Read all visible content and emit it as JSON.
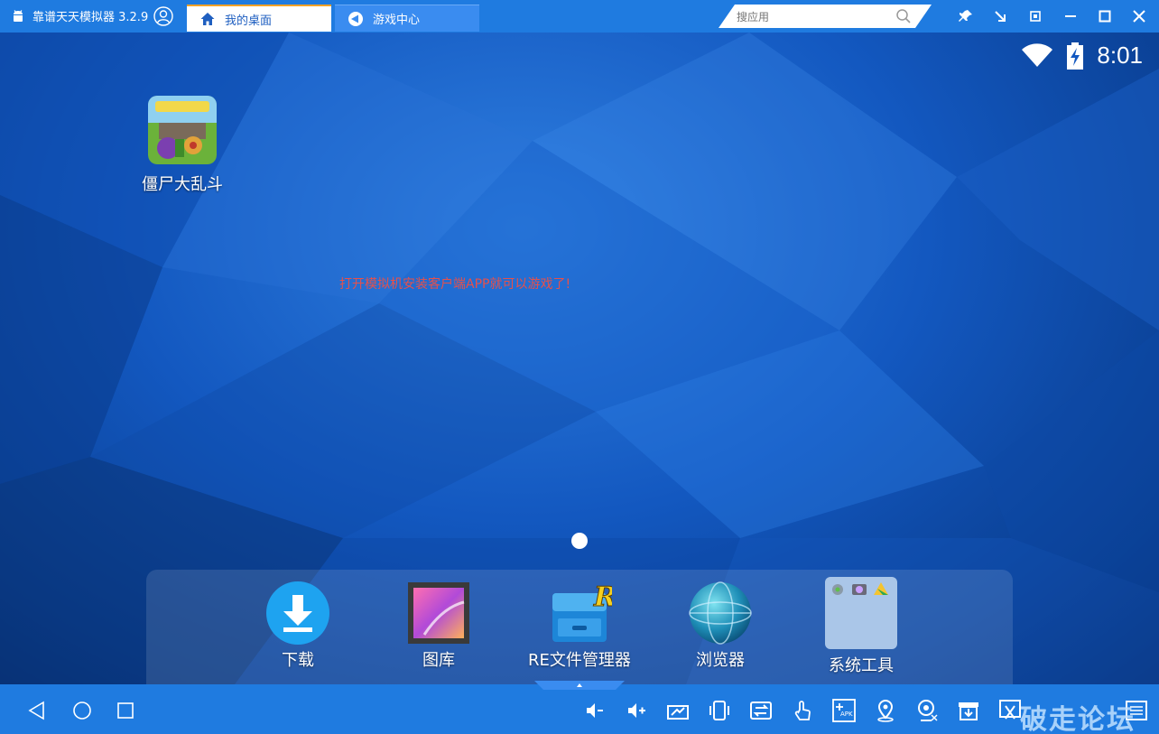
{
  "titlebar": {
    "app_name": "靠谱天天模拟器 3.2.9",
    "tabs": [
      {
        "label": "我的桌面",
        "icon": "home-icon",
        "active": true
      },
      {
        "label": "游戏中心",
        "icon": "gamepad-icon",
        "active": false
      }
    ],
    "search": {
      "placeholder": "搜应用",
      "icon": "search-icon"
    },
    "window_buttons": [
      "pin-icon",
      "arrow-down-right-icon",
      "mini-mode-icon",
      "minimize-icon",
      "maximize-icon",
      "close-icon"
    ]
  },
  "status_bar": {
    "time": "8:01",
    "icons": [
      "wifi-icon",
      "battery-charging-icon"
    ]
  },
  "desktop": {
    "apps": [
      {
        "label": "僵尸大乱斗",
        "icon": "zombie-game-icon"
      }
    ],
    "hint_text": "打开模拟机安装客户端APP就可以游戏了!",
    "page_count": 1
  },
  "dock": {
    "items": [
      {
        "label": "下载",
        "icon": "download-icon"
      },
      {
        "label": "图库",
        "icon": "gallery-icon"
      },
      {
        "label": "RE文件管理器",
        "icon": "file-manager-icon"
      },
      {
        "label": "浏览器",
        "icon": "browser-globe-icon"
      },
      {
        "label": "系统工具",
        "icon": "system-tools-folder-icon"
      }
    ]
  },
  "bottom_bar": {
    "nav": [
      "back-icon",
      "home-circle-icon",
      "recents-icon"
    ],
    "tools": [
      "volume-down-icon",
      "volume-up-icon",
      "screenshot-icon",
      "shake-icon",
      "rotate-icon",
      "touch-icon",
      "install-apk-icon",
      "location-icon",
      "camera-icon",
      "box-icon",
      "cut-icon",
      "fullscreen-icon"
    ],
    "apk_label": "APK",
    "watermark": "破走论坛"
  },
  "colors": {
    "titlebar_bg": "#1f7be0",
    "tab_active_accent": "#f2a227",
    "hint_text_color": "#e8504a"
  }
}
